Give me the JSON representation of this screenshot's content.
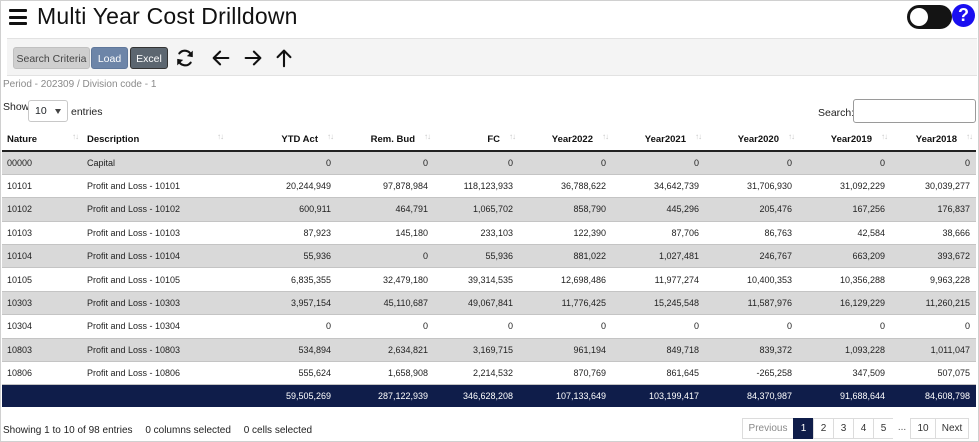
{
  "header": {
    "title": "Multi Year Cost Drilldown",
    "help_label": "?"
  },
  "toolbar": {
    "search_criteria_label": "Search Criteria",
    "load_label": "Load",
    "excel_label": "Excel"
  },
  "period_text": "Period - 202309 / Division code - 1",
  "length_control": {
    "show_label": "Show",
    "value": "10",
    "entries_label": "entries"
  },
  "search": {
    "label": "Search:",
    "value": ""
  },
  "table": {
    "columns": [
      "Nature",
      "Description",
      "YTD Act",
      "Rem. Bud",
      "FC",
      "Year2022",
      "Year2021",
      "Year2020",
      "Year2019",
      "Year2018"
    ],
    "rows": [
      [
        "00000",
        "Capital",
        "0",
        "0",
        "0",
        "0",
        "0",
        "0",
        "0",
        "0"
      ],
      [
        "10101",
        "Profit and Loss - 10101",
        "20,244,949",
        "97,878,984",
        "118,123,933",
        "36,788,622",
        "34,642,739",
        "31,706,930",
        "31,092,229",
        "30,039,277"
      ],
      [
        "10102",
        "Profit and Loss - 10102",
        "600,911",
        "464,791",
        "1,065,702",
        "858,790",
        "445,296",
        "205,476",
        "167,256",
        "176,837"
      ],
      [
        "10103",
        "Profit and Loss - 10103",
        "87,923",
        "145,180",
        "233,103",
        "122,390",
        "87,706",
        "86,763",
        "42,584",
        "38,666"
      ],
      [
        "10104",
        "Profit and Loss - 10104",
        "55,936",
        "0",
        "55,936",
        "881,022",
        "1,027,481",
        "246,767",
        "663,209",
        "393,672"
      ],
      [
        "10105",
        "Profit and Loss - 10105",
        "6,835,355",
        "32,479,180",
        "39,314,535",
        "12,698,486",
        "11,977,274",
        "10,400,353",
        "10,356,288",
        "9,963,228"
      ],
      [
        "10303",
        "Profit and Loss - 10303",
        "3,957,154",
        "45,110,687",
        "49,067,841",
        "11,776,425",
        "15,245,548",
        "11,587,976",
        "16,129,229",
        "11,260,215"
      ],
      [
        "10304",
        "Profit and Loss - 10304",
        "0",
        "0",
        "0",
        "0",
        "0",
        "0",
        "0",
        "0"
      ],
      [
        "10803",
        "Profit and Loss - 10803",
        "534,894",
        "2,634,821",
        "3,169,715",
        "961,194",
        "849,718",
        "839,372",
        "1,093,228",
        "1,011,047"
      ],
      [
        "10806",
        "Profit and Loss - 10806",
        "555,624",
        "1,658,908",
        "2,214,532",
        "870,769",
        "861,645",
        "-265,258",
        "347,509",
        "507,075"
      ]
    ],
    "totals": [
      "",
      "",
      "59,505,269",
      "287,122,939",
      "346,628,208",
      "107,133,649",
      "103,199,417",
      "84,370,987",
      "91,688,644",
      "84,608,798"
    ]
  },
  "footer": {
    "info_text": "Showing 1 to 10 of 98 entries",
    "columns_selected": "0 columns selected",
    "cells_selected": "0 cells selected",
    "pagination": [
      "Previous",
      "1",
      "2",
      "3",
      "4",
      "5",
      "...",
      "10",
      "Next"
    ]
  },
  "colors": {
    "total_row_bg": "#0f1d4a",
    "load_button": "#6d85a8",
    "help_button": "#1a0ff0"
  },
  "icons": [
    "menu-icon",
    "theme-toggle",
    "help-icon",
    "refresh-icon",
    "arrow-left-icon",
    "arrow-right-icon",
    "arrow-up-icon",
    "sort-icon"
  ]
}
